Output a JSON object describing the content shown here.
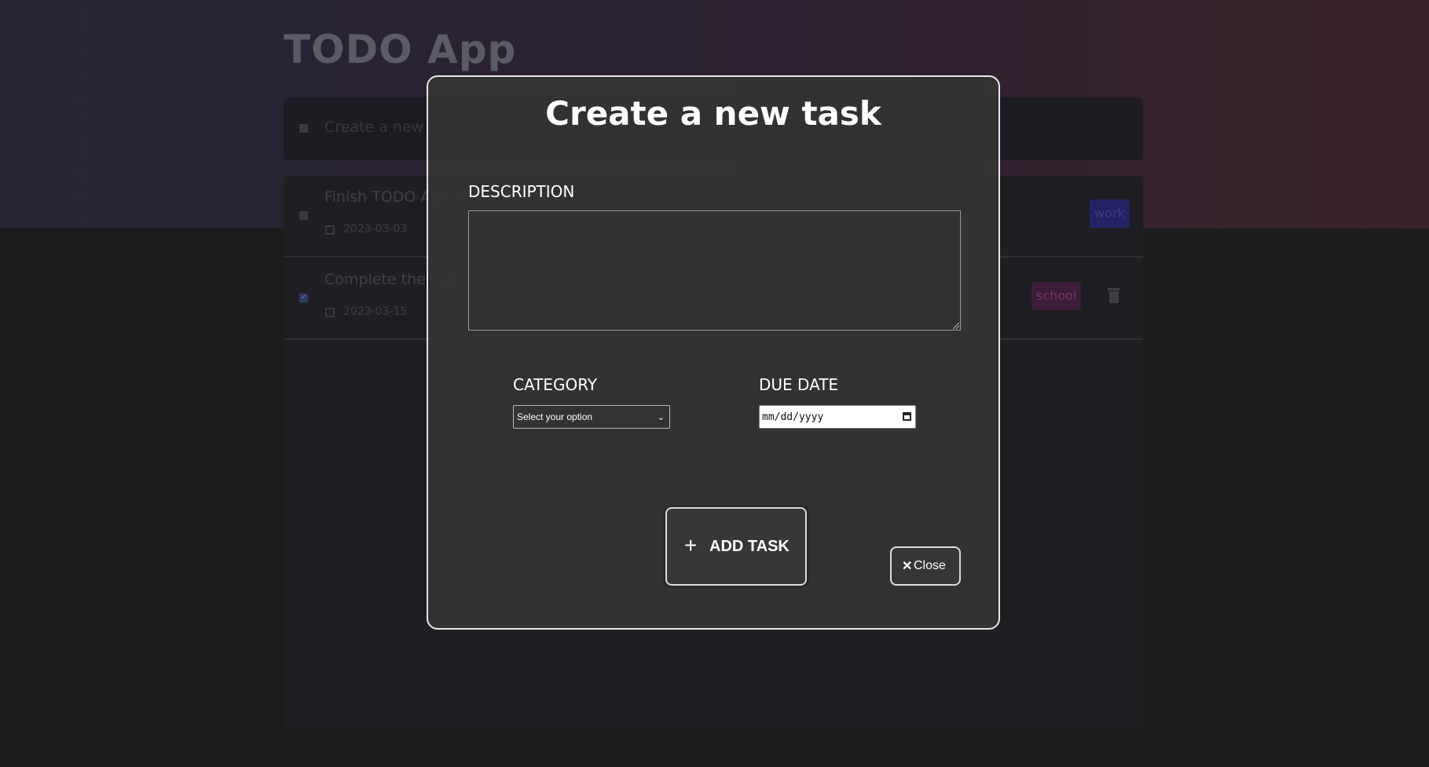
{
  "app": {
    "title": "TODO App"
  },
  "new_task": {
    "placeholder": "Create a new task..."
  },
  "tasks": [
    {
      "title": "Finish TODO App project",
      "date": "2023-03-03",
      "category": "work",
      "done": false
    },
    {
      "title": "Complete the course",
      "date": "2023-03-15",
      "category": "school",
      "done": true
    }
  ],
  "modal": {
    "title": "Create a new task",
    "description_label": "DESCRIPTION",
    "description_value": "",
    "category_label": "CATEGORY",
    "category_value": "Select your option",
    "due_date_label": "DUE DATE",
    "due_date_value": "mm/dd/yyyy",
    "add_button_label": "ADD TASK",
    "add_button_icon": "plus-icon",
    "close_button_label": "Close",
    "close_button_icon": "close-icon"
  },
  "colors": {
    "modal_border": "#e6e6e6",
    "modal_bg": "#343434",
    "tag_work_bg": "#232363",
    "tag_school_bg": "#3a1d3a"
  }
}
